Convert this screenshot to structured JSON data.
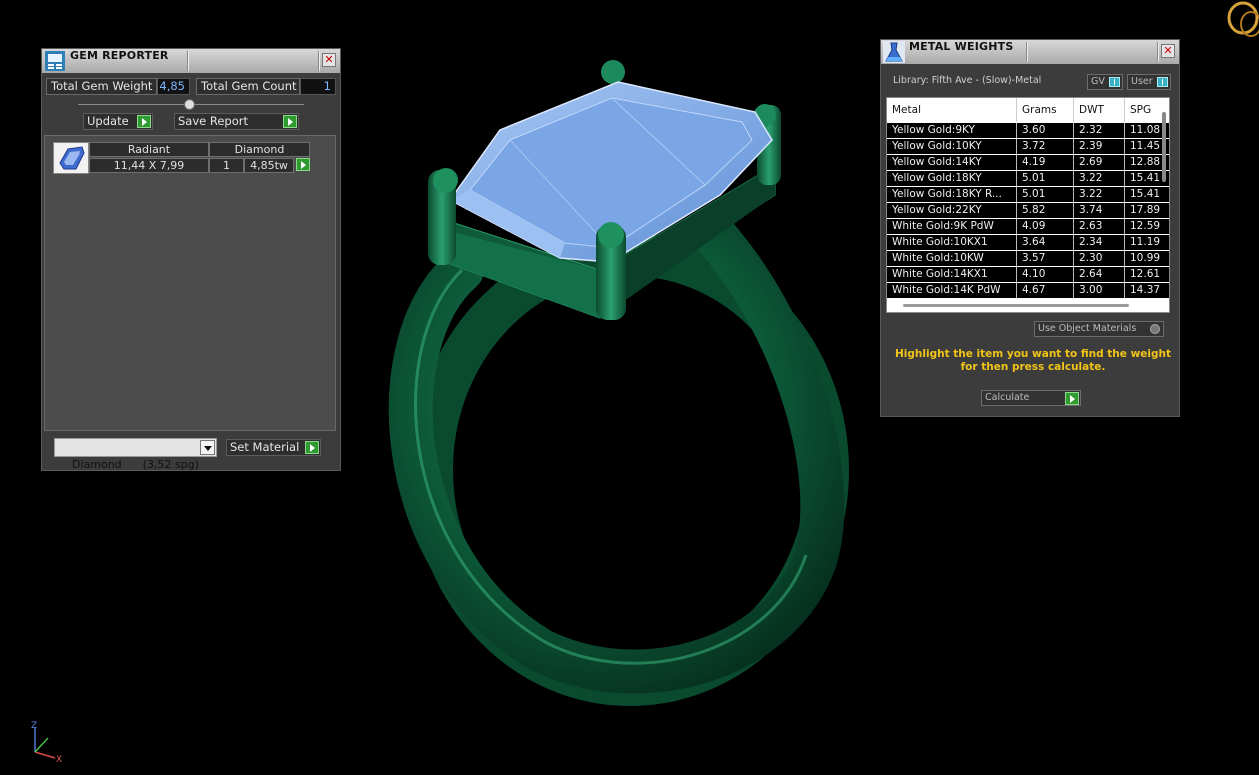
{
  "gem_reporter": {
    "title": "GEM REPORTER",
    "total_weight_label": "Total Gem Weight",
    "total_weight_value": "4,85",
    "total_count_label": "Total Gem Count",
    "total_count_value": "1",
    "update_label": "Update",
    "save_report_label": "Save Report",
    "gems": [
      {
        "shape": "Radiant",
        "material": "Diamond",
        "size": "11,44 X 7,99",
        "count": "1",
        "weight": "4,85tw"
      }
    ],
    "material_select": "Diamond      (3,52 spg)",
    "set_material_label": "Set Material"
  },
  "metal_weights": {
    "title": "METAL WEIGHTS",
    "library": "Library: Fifth Ave - (Slow)-Metal",
    "gv_label": "GV",
    "user_label": "User",
    "columns": [
      "Metal",
      "Grams",
      "DWT",
      "SPG"
    ],
    "rows": [
      [
        "Yellow Gold:9KY",
        "3.60",
        "2.32",
        "11.08"
      ],
      [
        "Yellow Gold:10KY",
        "3.72",
        "2.39",
        "11.45"
      ],
      [
        "Yellow Gold:14KY",
        "4.19",
        "2.69",
        "12.88"
      ],
      [
        "Yellow Gold:18KY",
        "5.01",
        "3.22",
        "15.41"
      ],
      [
        "Yellow Gold:18KY R...",
        "5.01",
        "3.22",
        "15.41"
      ],
      [
        "Yellow Gold:22KY",
        "5.82",
        "3.74",
        "17.89"
      ],
      [
        "White Gold:9K PdW",
        "4.09",
        "2.63",
        "12.59"
      ],
      [
        "White Gold:10KX1",
        "3.64",
        "2.34",
        "11.19"
      ],
      [
        "White Gold:10KW",
        "3.57",
        "2.30",
        "10.99"
      ],
      [
        "White Gold:14KX1",
        "4.10",
        "2.64",
        "12.61"
      ],
      [
        "White Gold:14K PdW",
        "4.67",
        "3.00",
        "14.37"
      ]
    ],
    "use_object_materials_label": "Use Object Materials",
    "hint": "Highlight the item you want to find the weight for then press calculate.",
    "calculate_label": "Calculate"
  },
  "axis": {
    "z": "Z",
    "x": "X"
  },
  "colors": {
    "ring": "#0f5c3d",
    "gem": "#7aa6e6",
    "hint": "#f2c417",
    "accent_go": "#2f9a2f",
    "value_text": "#7fb6ff"
  },
  "icons": [
    "gem-reporter-icon",
    "metal-weights-flask-icon",
    "close-icon",
    "play-arrow-icon",
    "dropdown-arrow-icon",
    "rings-logo-icon"
  ]
}
